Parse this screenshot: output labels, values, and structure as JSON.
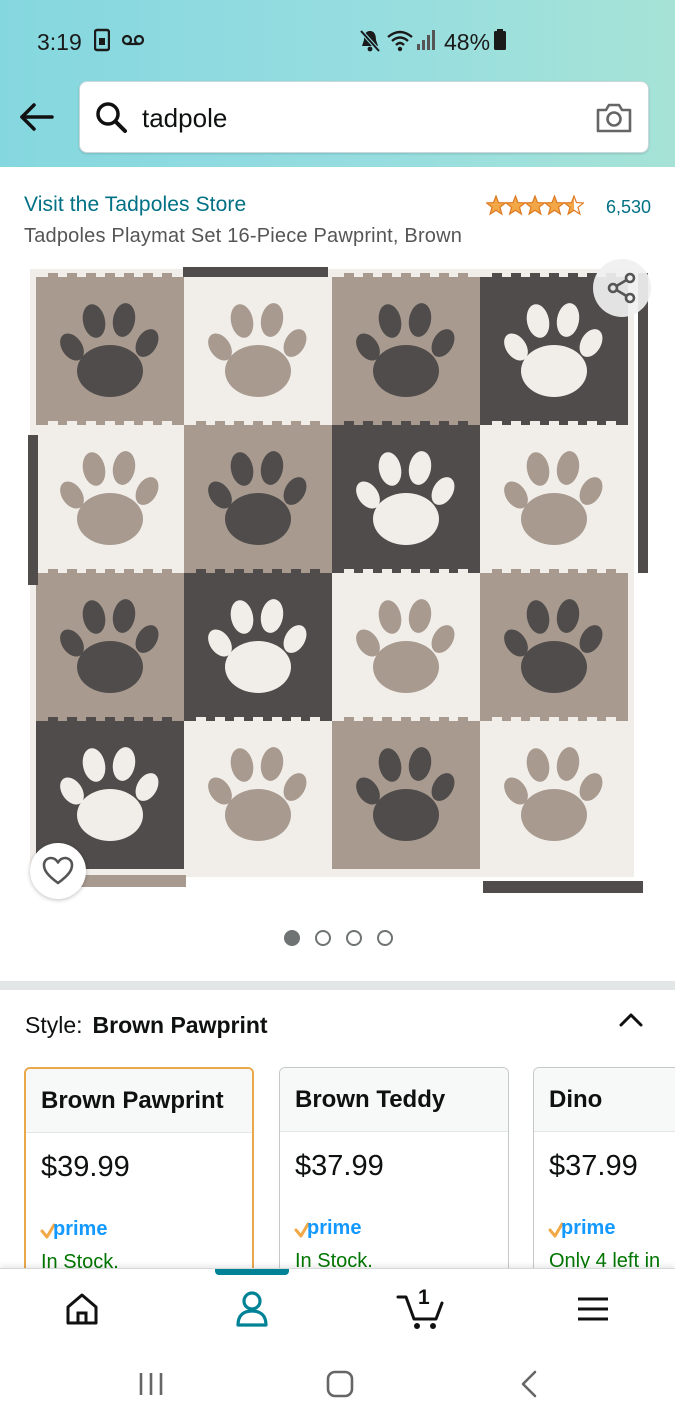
{
  "status_bar": {
    "time": "3:19",
    "battery_percent": "48%",
    "icons": [
      "sim-icon",
      "voicemail-icon",
      "mute-icon",
      "wifi-icon",
      "signal-icon",
      "battery-icon"
    ]
  },
  "search": {
    "query": "tadpole",
    "icons": [
      "back-arrow-icon",
      "search-icon",
      "camera-icon"
    ]
  },
  "product": {
    "store_link": "Visit the Tadpoles Store",
    "rating_stars": 4.5,
    "rating_count": "6,530",
    "title": "Tadpoles Playmat Set 16-Piece Pawprint, Brown",
    "image_count": 4,
    "active_image_index": 0
  },
  "style_selector": {
    "label": "Style:",
    "selected_value": "Brown Pawprint",
    "options": [
      {
        "name": "Brown Pawprint",
        "price": "$39.99",
        "prime": "prime",
        "stock": "In Stock."
      },
      {
        "name": "Brown Teddy",
        "price": "$37.99",
        "prime": "prime",
        "stock": "In Stock."
      },
      {
        "name": "Dino",
        "price": "$37.99",
        "prime": "prime",
        "stock": "Only 4 left in"
      }
    ]
  },
  "bottom_nav": {
    "items": [
      "home-icon",
      "account-icon",
      "cart-icon",
      "menu-icon"
    ],
    "cart_count": "1",
    "active_item": "account-icon"
  },
  "colors": {
    "link": "#007185",
    "stock_green": "#007600",
    "selected_border": "#e9a84b",
    "accent_teal": "#008296",
    "star": "#f3a847",
    "prime_blue": "#1399ff"
  }
}
